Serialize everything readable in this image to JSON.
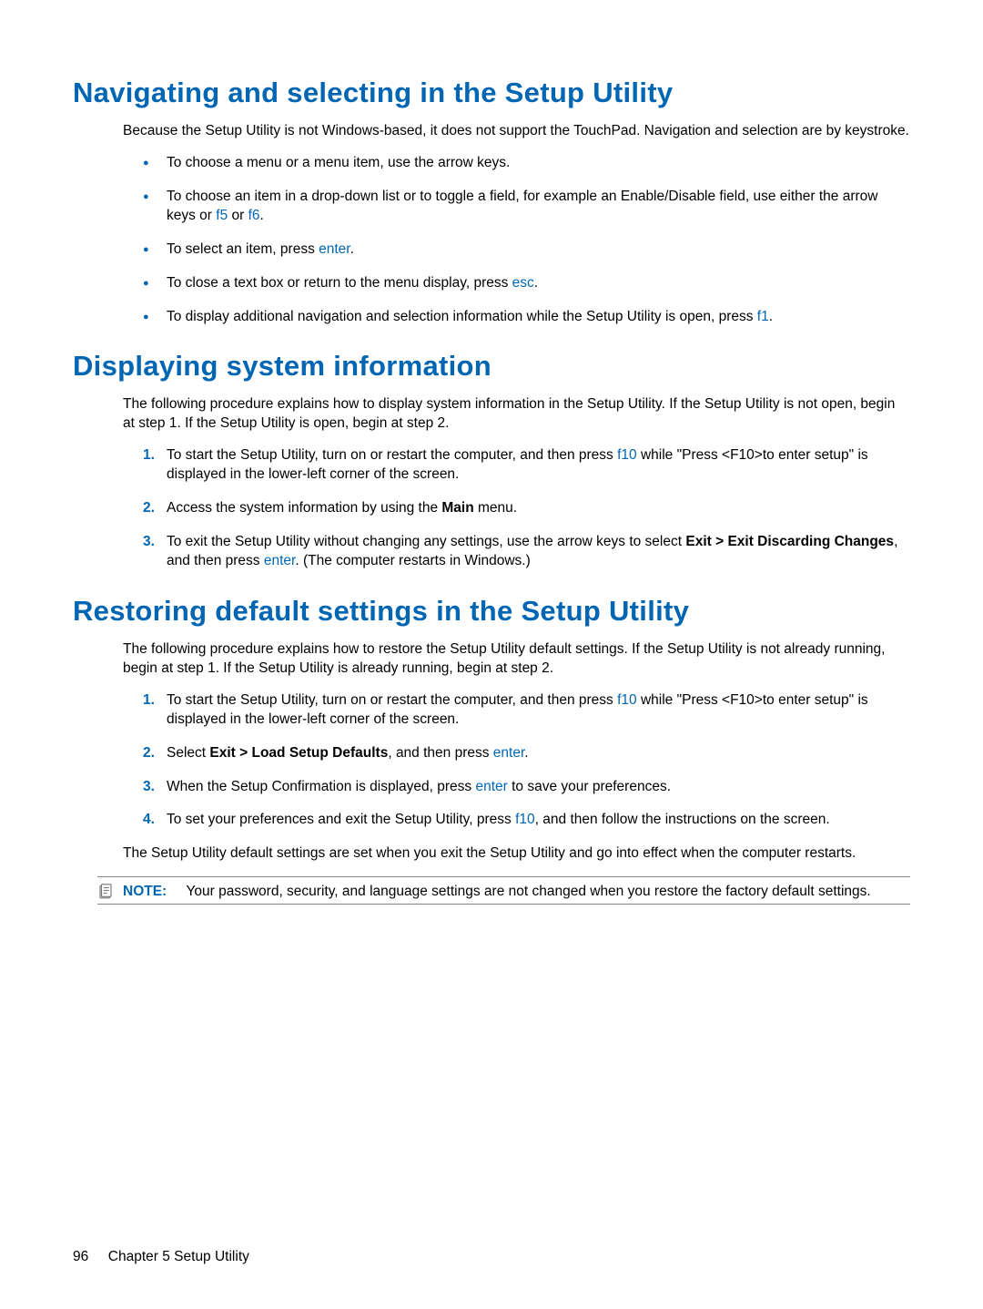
{
  "section1": {
    "heading": "Navigating and selecting in the Setup Utility",
    "intro": "Because the Setup Utility is not Windows-based, it does not support the TouchPad. Navigation and selection are by keystroke.",
    "bullets": {
      "b1": "To choose a menu or a menu item, use the arrow keys.",
      "b2_part1": "To choose an item in a drop-down list or to toggle a field, for example an Enable/Disable field, use either the arrow keys or ",
      "b2_key1": "f5",
      "b2_or": " or ",
      "b2_key2": "f6",
      "b2_end": ".",
      "b3_part1": "To select an item, press ",
      "b3_key": "enter",
      "b3_end": ".",
      "b4_part1": "To close a text box or return to the menu display, press ",
      "b4_key": "esc",
      "b4_end": ".",
      "b5_part1": "To display additional navigation and selection information while the Setup Utility is open, press ",
      "b5_key": "f1",
      "b5_end": "."
    }
  },
  "section2": {
    "heading": "Displaying system information",
    "intro": "The following procedure explains how to display system information in the Setup Utility. If the Setup Utility is not open, begin at step 1. If the Setup Utility is open, begin at step 2.",
    "steps": {
      "s1_num": "1.",
      "s1_part1": "To start the Setup Utility, turn on or restart the computer, and then press ",
      "s1_key": "f10",
      "s1_part2": " while \"Press <F10>to enter setup\" is displayed in the lower-left corner of the screen.",
      "s2_num": "2.",
      "s2_part1": "Access the system information by using the ",
      "s2_bold": "Main",
      "s2_part2": " menu.",
      "s3_num": "3.",
      "s3_part1": "To exit the Setup Utility without changing any settings, use the arrow keys to select ",
      "s3_bold": "Exit > Exit Discarding Changes",
      "s3_part2": ", and then press ",
      "s3_key": "enter",
      "s3_part3": ". (The computer restarts in Windows.)"
    }
  },
  "section3": {
    "heading": "Restoring default settings in the Setup Utility",
    "intro": "The following procedure explains how to restore the Setup Utility default settings. If the Setup Utility is not already running, begin at step 1. If the Setup Utility is already running, begin at step 2.",
    "steps": {
      "s1_num": "1.",
      "s1_part1": "To start the Setup Utility, turn on or restart the computer, and then press ",
      "s1_key": "f10",
      "s1_part2": " while \"Press <F10>to enter setup\" is displayed in the lower-left corner of the screen.",
      "s2_num": "2.",
      "s2_part1": "Select ",
      "s2_bold": "Exit > Load Setup Defaults",
      "s2_part2": ", and then press ",
      "s2_key": "enter",
      "s2_end": ".",
      "s3_num": "3.",
      "s3_part1": "When the Setup Confirmation is displayed, press ",
      "s3_key": "enter",
      "s3_part2": " to save your preferences.",
      "s4_num": "4.",
      "s4_part1": "To set your preferences and exit the Setup Utility, press ",
      "s4_key": "f10",
      "s4_part2": ", and then follow the instructions on the screen."
    },
    "outro": "The Setup Utility default settings are set when you exit the Setup Utility and go into effect when the computer restarts.",
    "note_label": "NOTE:",
    "note_text": "Your password, security, and language settings are not changed when you restore the factory default settings."
  },
  "footer": {
    "page": "96",
    "chapter": "Chapter 5   Setup Utility"
  }
}
